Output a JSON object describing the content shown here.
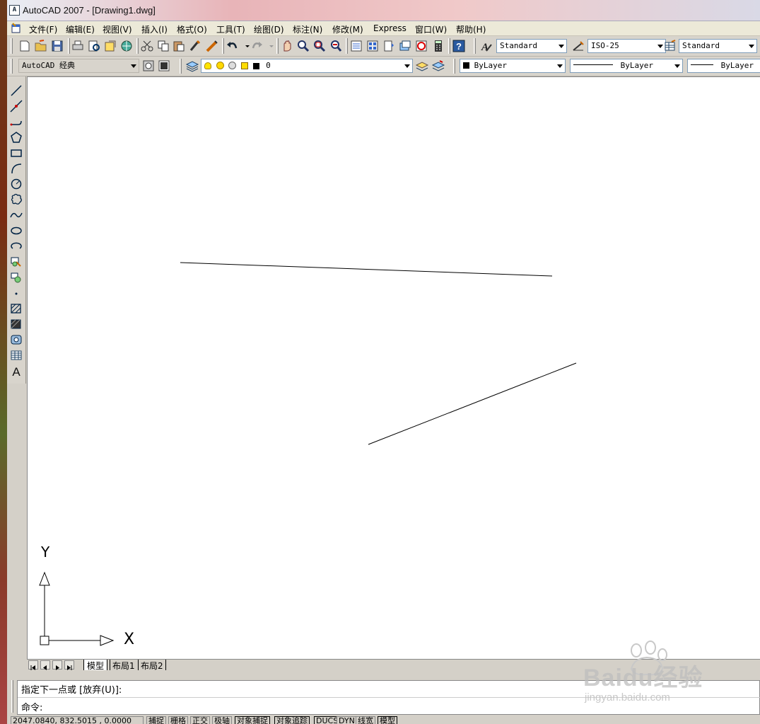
{
  "window": {
    "title": "AutoCAD 2007 - [Drawing1.dwg]"
  },
  "menubar": {
    "items": [
      "文件(F)",
      "编辑(E)",
      "视图(V)",
      "插入(I)",
      "格式(O)",
      "工具(T)",
      "绘图(D)",
      "标注(N)",
      "修改(M)",
      "Express",
      "窗口(W)",
      "帮助(H)"
    ]
  },
  "styles": {
    "text_style": "Standard",
    "dim_style": "ISO-25",
    "table_style": "Standard"
  },
  "workspace": {
    "value": "AutoCAD 经典"
  },
  "layer": {
    "current": "0"
  },
  "properties": {
    "color": "ByLayer",
    "linetype": "ByLayer",
    "lineweight": "ByLayer"
  },
  "layout_tabs": [
    "模型",
    "布局1",
    "布局2"
  ],
  "ucs": {
    "x_label": "X",
    "y_label": "Y"
  },
  "command": {
    "line1": "指定下一点或 [放弃(U)]:",
    "line2": "命令:"
  },
  "status": {
    "coords": "2047.0840, 832.5015 , 0.0000",
    "toggles": [
      "捕捉",
      "栅格",
      "正交",
      "极轴",
      "对象捕捉",
      "对象追踪",
      "DUCS",
      "DYN",
      "线宽",
      "模型"
    ]
  },
  "watermark": {
    "brand": "Baidu经验",
    "url": "jingyan.baidu.com"
  },
  "drawing": {
    "entity_type": "line",
    "entity_count": 2
  },
  "colors": {
    "canvas_bg": "#ffffff",
    "toolbar_bg": "#d8d4cc",
    "line": "#000000"
  }
}
